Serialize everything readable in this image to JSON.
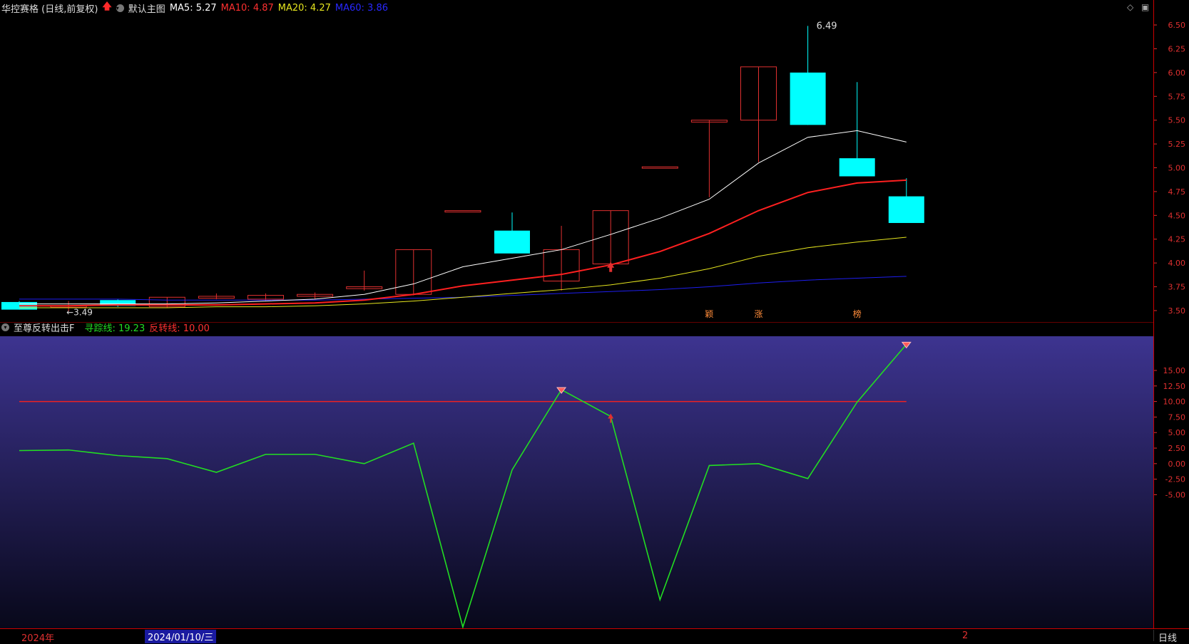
{
  "header": {
    "title": "华控赛格 (日线,前复权)",
    "template": "默认主图",
    "ma5_label": "MA5: 5.27",
    "ma10_label": "MA10: 4.87",
    "ma20_label": "MA20: 4.27",
    "ma60_label": "MA60: 3.86",
    "window_ctrl_1": "◇",
    "window_ctrl_2": "▣"
  },
  "indicator_header": {
    "name": "至尊反转出击F",
    "line1_label": "寻踪线: 19.23",
    "line2_label": "反转线: 10.00"
  },
  "colors": {
    "up": "#e03030",
    "down": "#00ffff",
    "ma5": "#ffffff",
    "ma10": "#ff2020",
    "ma20": "#e6e61e",
    "ma60": "#1e1ef0",
    "track": "#22dd22",
    "reverse": "#ee2222",
    "axis_text": "#e03030"
  },
  "chart_data": [
    {
      "type": "candlestick",
      "ylim": [
        3.38,
        6.62
      ],
      "yticks": [
        "6.50",
        "6.25",
        "6.00",
        "5.75",
        "5.50",
        "5.25",
        "5.00",
        "4.75",
        "4.50",
        "4.25",
        "4.00",
        "3.75",
        "3.50"
      ],
      "candles": [
        {
          "o": 3.59,
          "c": 3.51,
          "h": 3.6,
          "l": 3.51
        },
        {
          "o": 3.54,
          "c": 3.55,
          "h": 3.6,
          "l": 3.49
        },
        {
          "o": 3.61,
          "c": 3.55,
          "h": 3.62,
          "l": 3.54
        },
        {
          "o": 3.54,
          "c": 3.64,
          "h": 3.64,
          "l": 3.53
        },
        {
          "o": 3.63,
          "c": 3.65,
          "h": 3.68,
          "l": 3.62
        },
        {
          "o": 3.62,
          "c": 3.66,
          "h": 3.68,
          "l": 3.6
        },
        {
          "o": 3.65,
          "c": 3.67,
          "h": 3.69,
          "l": 3.62
        },
        {
          "o": 3.73,
          "c": 3.75,
          "h": 3.92,
          "l": 3.71
        },
        {
          "o": 3.67,
          "c": 4.14,
          "h": 4.14,
          "l": 3.66
        },
        {
          "o": 4.55,
          "c": 4.55,
          "h": 4.55,
          "l": 4.55
        },
        {
          "o": 4.34,
          "c": 4.1,
          "h": 4.53,
          "l": 4.1
        },
        {
          "o": 3.81,
          "c": 4.14,
          "h": 4.39,
          "l": 3.71
        },
        {
          "o": 3.99,
          "c": 4.55,
          "h": 4.55,
          "l": 3.99
        },
        {
          "o": 5.01,
          "c": 5.01,
          "h": 5.01,
          "l": 5.01
        },
        {
          "o": 5.48,
          "c": 5.5,
          "h": 5.5,
          "l": 4.69
        },
        {
          "o": 5.5,
          "c": 6.06,
          "h": 6.06,
          "l": 5.06
        },
        {
          "o": 6.0,
          "c": 5.45,
          "h": 6.49,
          "l": 5.45
        },
        {
          "o": 5.1,
          "c": 4.91,
          "h": 5.9,
          "l": 4.91
        },
        {
          "o": 4.7,
          "c": 4.42,
          "h": 4.89,
          "l": 4.42
        }
      ],
      "ma5": [
        3.57,
        3.57,
        3.57,
        3.57,
        3.58,
        3.6,
        3.62,
        3.67,
        3.78,
        3.96,
        4.05,
        4.14,
        4.3,
        4.47,
        4.67,
        5.05,
        5.32,
        5.39,
        5.27
      ],
      "ma10": [
        3.55,
        3.55,
        3.56,
        3.56,
        3.56,
        3.57,
        3.58,
        3.61,
        3.67,
        3.76,
        3.82,
        3.88,
        3.98,
        4.12,
        4.31,
        4.55,
        4.74,
        4.84,
        4.87
      ],
      "ma20": [
        3.53,
        3.53,
        3.53,
        3.53,
        3.54,
        3.54,
        3.55,
        3.57,
        3.6,
        3.64,
        3.68,
        3.72,
        3.77,
        3.84,
        3.94,
        4.07,
        4.16,
        4.22,
        4.27
      ],
      "ma60": [
        3.62,
        3.62,
        3.62,
        3.61,
        3.61,
        3.61,
        3.61,
        3.62,
        3.63,
        3.64,
        3.66,
        3.68,
        3.7,
        3.72,
        3.75,
        3.79,
        3.82,
        3.84,
        3.86
      ],
      "annotations": {
        "high_label": "6.49",
        "low_label": "←3.49",
        "tags": [
          "颖",
          "涨",
          "榜"
        ]
      }
    },
    {
      "type": "line",
      "ylim": [
        -26.5,
        20.5
      ],
      "yticks": [
        "15.00",
        "12.50",
        "10.00",
        "7.50",
        "5.00",
        "2.50",
        "0.00",
        "-2.50",
        "-5.00"
      ],
      "series": [
        {
          "name": "寻踪线",
          "values": [
            2.1,
            2.2,
            1.3,
            0.8,
            -1.4,
            1.5,
            1.5,
            0.0,
            3.3,
            -26.3,
            -1.0,
            11.9,
            7.6,
            -21.9,
            -0.3,
            0.0,
            -2.4,
            9.9,
            19.2
          ]
        },
        {
          "name": "反转线",
          "values": [
            10,
            10,
            10,
            10,
            10,
            10,
            10,
            10,
            10,
            10,
            10,
            10,
            10,
            10,
            10,
            10,
            10,
            10,
            10
          ]
        }
      ]
    }
  ],
  "bottom_bar": {
    "year_label": "2024年",
    "date_label": "2024/01/10/三",
    "right_number": "2",
    "period_label": "日线"
  }
}
